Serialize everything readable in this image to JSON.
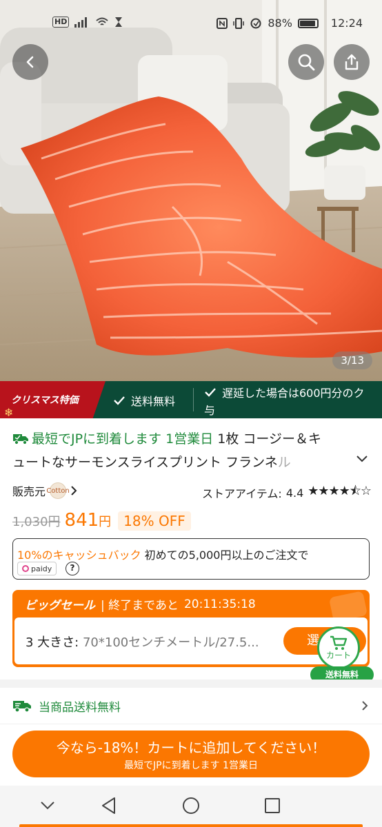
{
  "status_bar": {
    "network_badge": "HD",
    "battery_text": "88%",
    "time": "12:24"
  },
  "hero": {
    "page_counter": "3/13"
  },
  "promo_banner": {
    "xmas_label": "クリスマス特価",
    "free_shipping": "送料無料",
    "delay_line1": "遅延した場合は600円分のク",
    "delay_line2": "与"
  },
  "product": {
    "delivery_badge": "最短でJPに到着します 1営業日",
    "title_line1": "1枚 コージー＆キ",
    "title_line2_dark": "ュートなサーモンスライスプリント フランネ",
    "title_line2_fade": "ル"
  },
  "seller": {
    "label": "販売元",
    "logo_text": "Cotton",
    "store_items_label": "ストアアイテム:",
    "store_rating": "4.4"
  },
  "price": {
    "original": "1,030円",
    "current": "841",
    "currency": "円",
    "discount": "18% OFF"
  },
  "cashback": {
    "highlight": "10%のキャッシュバック",
    "condition": " 初めての5,000円以上のご注文で",
    "paidy_label": "paidy",
    "help": "?"
  },
  "big_sale": {
    "title": "ビッグセール",
    "ends_label": "| 終了まであと",
    "countdown": "20:11:35:18",
    "size_prefix": "3 大きさ:",
    "size_value": "70*100センチメートル/27.5...",
    "select_label": "選"
  },
  "cart_fab": {
    "label": "カート",
    "free_shipping": "送料無料"
  },
  "shipping_row": {
    "text": "当商品送料無料"
  },
  "cta": {
    "line1": "今なら-18%！カートに追加してください！",
    "line2": "最短でJPに到着します 1営業日"
  },
  "colors": {
    "accent_orange": "#fb7701",
    "banner_green": "#0c4a37",
    "xmas_red": "#b8131c",
    "shipping_green": "#1f8a3b"
  },
  "icons": [
    "back-icon",
    "search-icon",
    "share-icon",
    "checkmark-icon",
    "truck-icon",
    "chevron-down-icon",
    "chevron-right-icon",
    "star-icon",
    "cart-icon",
    "nav-back-icon",
    "nav-home-icon",
    "nav-recents-icon",
    "nav-collapse-icon"
  ]
}
